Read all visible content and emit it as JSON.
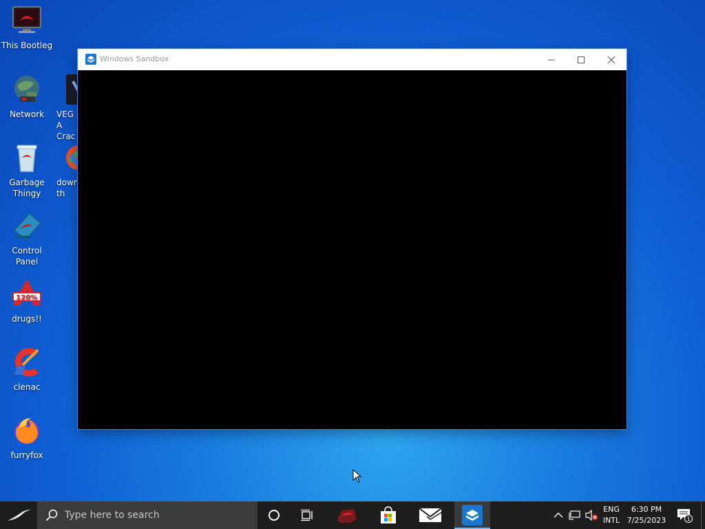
{
  "desktop": {
    "icons": [
      {
        "label": "This Bootleg",
        "icon": "monitor-icon"
      },
      {
        "label": "Network",
        "icon": "globe-network-icon"
      },
      {
        "label": "VEGA Crac",
        "icon": "vegas-app-icon"
      },
      {
        "label": "Garbage Thingy",
        "icon": "recycle-bin-icon"
      },
      {
        "label": "down th",
        "icon": "download-app-icon"
      },
      {
        "label": "Control Panel",
        "icon": "control-panel-icon"
      },
      {
        "label": "drugs!!",
        "icon": "acrobat-app-icon"
      },
      {
        "label": "clenac",
        "icon": "ccleaner-icon"
      },
      {
        "label": "furryfox",
        "icon": "firefox-icon"
      }
    ]
  },
  "window": {
    "title": "Windows Sandbox",
    "content_color": "#000000"
  },
  "taskbar": {
    "search_placeholder": "Type here to search",
    "language_line1": "ENG",
    "language_line2": "INTL",
    "time": "6:30 PM",
    "date": "7/25/2023",
    "notification_count": "1"
  },
  "colors": {
    "desktop_blue": "#1a7fe0",
    "taskbar": "#1d1d1d",
    "sandbox_accent": "#1976d2"
  }
}
